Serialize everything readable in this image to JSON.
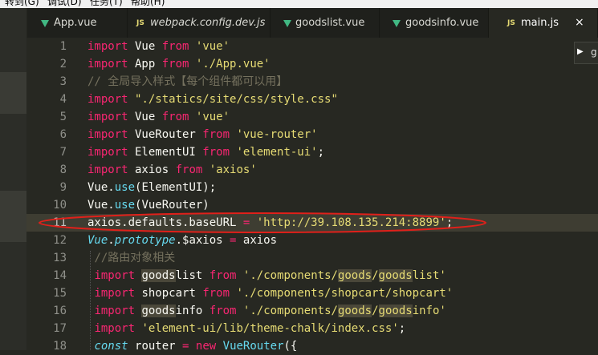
{
  "menu": [
    "转到(G)",
    "调试(D)",
    "任务(T)",
    "帮助(H)"
  ],
  "tabs": [
    {
      "label": "App.vue",
      "icon": "vue"
    },
    {
      "label": "webpack.config.dev.js",
      "icon": "js"
    },
    {
      "label": "goodslist.vue",
      "icon": "vue"
    },
    {
      "label": "goodsinfo.vue",
      "icon": "vue"
    },
    {
      "label": "main.js",
      "icon": "js"
    }
  ],
  "js_badge": "JS",
  "close_glyph": "×",
  "minimap": {
    "arrow": "▶",
    "text": "g"
  },
  "current_line": 11,
  "lines": [
    {
      "n": "1",
      "parts": [
        [
          "k",
          "import"
        ],
        [
          "t",
          " Vue "
        ],
        [
          "k",
          "from"
        ],
        [
          "t",
          " "
        ],
        [
          "s",
          "'vue'"
        ]
      ]
    },
    {
      "n": "2",
      "parts": [
        [
          "k",
          "import"
        ],
        [
          "t",
          " App "
        ],
        [
          "k",
          "from"
        ],
        [
          "t",
          " "
        ],
        [
          "s",
          "'./App.vue'"
        ]
      ]
    },
    {
      "n": "3",
      "parts": [
        [
          "c",
          "// 全局导入样式【每个组件都可以用】"
        ]
      ]
    },
    {
      "n": "4",
      "parts": [
        [
          "k",
          "import"
        ],
        [
          "t",
          " "
        ],
        [
          "s",
          "\"./statics/site/css/style.css\""
        ]
      ]
    },
    {
      "n": "5",
      "parts": [
        [
          "k",
          "import"
        ],
        [
          "t",
          " Vue "
        ],
        [
          "k",
          "from"
        ],
        [
          "t",
          " "
        ],
        [
          "s",
          "'vue'"
        ]
      ]
    },
    {
      "n": "6",
      "parts": [
        [
          "k",
          "import"
        ],
        [
          "t",
          " VueRouter "
        ],
        [
          "k",
          "from"
        ],
        [
          "t",
          " "
        ],
        [
          "s",
          "'vue-router'"
        ]
      ]
    },
    {
      "n": "7",
      "parts": [
        [
          "k",
          "import"
        ],
        [
          "t",
          " ElementUI "
        ],
        [
          "k",
          "from"
        ],
        [
          "t",
          " "
        ],
        [
          "s",
          "'element-ui'"
        ],
        [
          "t",
          ";"
        ]
      ]
    },
    {
      "n": "8",
      "parts": [
        [
          "k",
          "import"
        ],
        [
          "t",
          " axios "
        ],
        [
          "k",
          "from"
        ],
        [
          "t",
          " "
        ],
        [
          "s",
          "'axios'"
        ]
      ]
    },
    {
      "n": "9",
      "parts": [
        [
          "t",
          "Vue."
        ],
        [
          "f",
          "use"
        ],
        [
          "t",
          "(ElementUI);"
        ]
      ]
    },
    {
      "n": "10",
      "parts": [
        [
          "t",
          "Vue."
        ],
        [
          "f",
          "use"
        ],
        [
          "t",
          "(VueRouter)"
        ]
      ]
    },
    {
      "n": "11",
      "parts": [
        [
          "t",
          "axios.defaults.baseURL "
        ],
        [
          "k",
          "="
        ],
        [
          "t",
          " "
        ],
        [
          "s",
          "'http://39.108.135.214:8899'"
        ],
        [
          "t",
          ";"
        ]
      ]
    },
    {
      "n": "12",
      "parts": [
        [
          "it",
          "Vue"
        ],
        [
          "t",
          "."
        ],
        [
          "it",
          "prototype"
        ],
        [
          "t",
          ".$axios "
        ],
        [
          "k",
          "="
        ],
        [
          "t",
          " axios"
        ]
      ]
    },
    {
      "n": "13",
      "parts": [
        [
          "t",
          " "
        ],
        [
          "c",
          "//路由对象相关"
        ]
      ]
    },
    {
      "n": "14",
      "parts": [
        [
          "t",
          " "
        ],
        [
          "k",
          "import"
        ],
        [
          "t",
          " "
        ],
        [
          "hl",
          "goods"
        ],
        [
          "t",
          "list "
        ],
        [
          "k",
          "from"
        ],
        [
          "t",
          " "
        ],
        [
          "s",
          "'./components/"
        ],
        [
          "hs",
          "goods"
        ],
        [
          "s",
          "/"
        ],
        [
          "hs",
          "goods"
        ],
        [
          "s",
          "list'"
        ]
      ]
    },
    {
      "n": "15",
      "parts": [
        [
          "t",
          " "
        ],
        [
          "k",
          "import"
        ],
        [
          "t",
          " shopcart "
        ],
        [
          "k",
          "from"
        ],
        [
          "t",
          " "
        ],
        [
          "s",
          "'./components/shopcart/shopcart'"
        ]
      ]
    },
    {
      "n": "16",
      "parts": [
        [
          "t",
          " "
        ],
        [
          "k",
          "import"
        ],
        [
          "t",
          " "
        ],
        [
          "hl",
          "goods"
        ],
        [
          "t",
          "info "
        ],
        [
          "k",
          "from"
        ],
        [
          "t",
          " "
        ],
        [
          "s",
          "'./components/"
        ],
        [
          "hs",
          "goods"
        ],
        [
          "s",
          "/"
        ],
        [
          "hs",
          "goods"
        ],
        [
          "s",
          "info'"
        ]
      ]
    },
    {
      "n": "17",
      "parts": [
        [
          "t",
          " "
        ],
        [
          "k",
          "import"
        ],
        [
          "t",
          " "
        ],
        [
          "s",
          "'element-ui/lib/theme-chalk/index.css'"
        ],
        [
          "t",
          ";"
        ]
      ]
    },
    {
      "n": "18",
      "parts": [
        [
          "t",
          " "
        ],
        [
          "it",
          "const"
        ],
        [
          "t",
          " router "
        ],
        [
          "k",
          "="
        ],
        [
          "t",
          " "
        ],
        [
          "k",
          "new"
        ],
        [
          "t",
          " "
        ],
        [
          "f",
          "VueRouter"
        ],
        [
          "t",
          "({"
        ]
      ]
    }
  ]
}
